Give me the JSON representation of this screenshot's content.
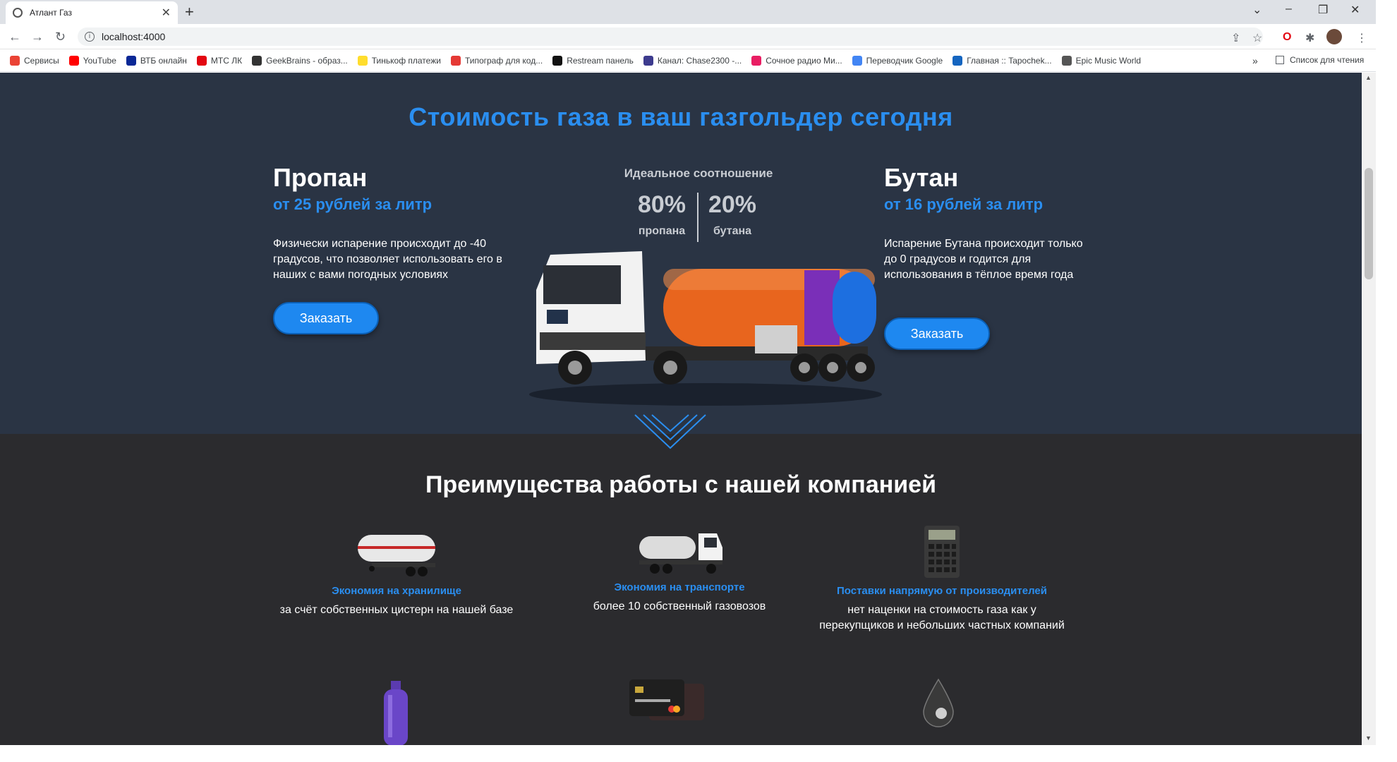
{
  "browser": {
    "tab_title": "Атлант Газ",
    "url": "localhost:4000",
    "bookmarks": [
      {
        "label": "Сервисы",
        "color": "#ea4335"
      },
      {
        "label": "YouTube",
        "color": "#ff0000"
      },
      {
        "label": "ВТБ онлайн",
        "color": "#0a2896"
      },
      {
        "label": "МТС ЛК",
        "color": "#e30611"
      },
      {
        "label": "GeekBrains - образ...",
        "color": "#333333"
      },
      {
        "label": "Тинькоф платежи",
        "color": "#ffdd2d"
      },
      {
        "label": "Типограф для код...",
        "color": "#e53935"
      },
      {
        "label": "Restream панель",
        "color": "#111111"
      },
      {
        "label": "Канал: Chase2300 -...",
        "color": "#3d3b8e"
      },
      {
        "label": "Сочное радио Ми...",
        "color": "#e91e63"
      },
      {
        "label": "Переводчик Google",
        "color": "#4285f4"
      },
      {
        "label": "Главная :: Tapochek...",
        "color": "#1565c0"
      },
      {
        "label": "Epic Music World",
        "color": "#555555"
      }
    ],
    "more": "»",
    "reading_list": "Список для чтения"
  },
  "prices": {
    "title": "Стоимость газа в ваш газгольдер сегодня",
    "propane": {
      "name": "Пропан",
      "price": "от 25 рублей за литр",
      "desc": "Физически испарение происходит до -40 градусов, что позволяет использовать его в наших с вами погодных условиях",
      "button": "Заказать"
    },
    "butane": {
      "name": "Бутан",
      "price": "от 16 рублей за литр",
      "desc": "Испарение Бутана происходит только до 0 градусов и годится для использования в тёплое время года",
      "button": "Заказать"
    },
    "ratio": {
      "title": "Идеальное соотношение",
      "propane_value": "80%",
      "propane_label": "пропана",
      "butane_value": "20%",
      "butane_label": "бутана"
    }
  },
  "advantages": {
    "title": "Преимущества работы с нашей компанией",
    "items": [
      {
        "title": "Экономия на хранилище",
        "text": "за счёт собственных цистерн на нашей базе"
      },
      {
        "title": "Экономия на транспорте",
        "text": "более 10 собственный газовозов"
      },
      {
        "title": "Поставки напрямую от производителей",
        "text": "нет наценки на стоимость газа как у перекупщиков и небольших частных компаний"
      }
    ]
  },
  "colors": {
    "accent": "#2a8ef0",
    "section_dark_blue": "#2a3444",
    "section_dark": "#2b2b2e"
  }
}
